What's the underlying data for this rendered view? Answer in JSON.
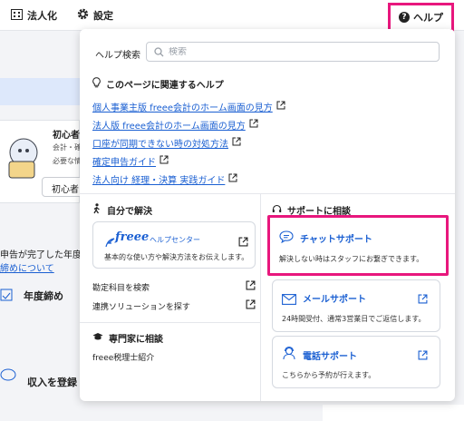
{
  "topbar": {
    "corp_label": "法人化",
    "settings_label": "設定",
    "help_label": "ヘルプ"
  },
  "background": {
    "card_title": "初心者の",
    "card_line1": "会計・確定",
    "card_line2": "必要な情報",
    "card_button": "初心者",
    "text_tax": "申告が完了した年度",
    "text_link": "締めについて",
    "year_end": "年度締め",
    "income": "収入を登録"
  },
  "dropdown": {
    "search": {
      "label": "ヘルプ検索",
      "placeholder": "検索"
    },
    "related": {
      "heading": "このページに関連するヘルプ",
      "links": [
        "個人事業主版 freee会計のホーム画面の見方",
        "法人版 freee会計のホーム画面の見方",
        "口座が同期できない時の対処方法",
        "確定申告ガイド",
        "法人向け 経理・決算 実践ガイド"
      ]
    },
    "self_solve": {
      "heading": "自分で解決",
      "helpcenter": {
        "logo": "freee",
        "logo_sub": "ヘルプセンター",
        "desc": "基本的な使い方や解決方法をお伝えします。"
      },
      "rows": [
        "勘定科目を検索",
        "連携ソリューションを探す"
      ]
    },
    "expert": {
      "heading": "専門家に相談",
      "row": "freee税理士紹介"
    },
    "support": {
      "heading": "サポートに相談",
      "chat": {
        "title": "チャットサポート",
        "desc": "解決しない時はスタッフにお繋ぎできます。"
      },
      "mail": {
        "title": "メールサポート",
        "desc": "24時間受付、通常3営業日でご返信します。"
      },
      "phone": {
        "title": "電話サポート",
        "desc": "こちらから予約が行えます。"
      }
    }
  },
  "colors": {
    "link": "#1a5fd2",
    "highlight": "#e8177d",
    "band": "#dde8fb"
  }
}
